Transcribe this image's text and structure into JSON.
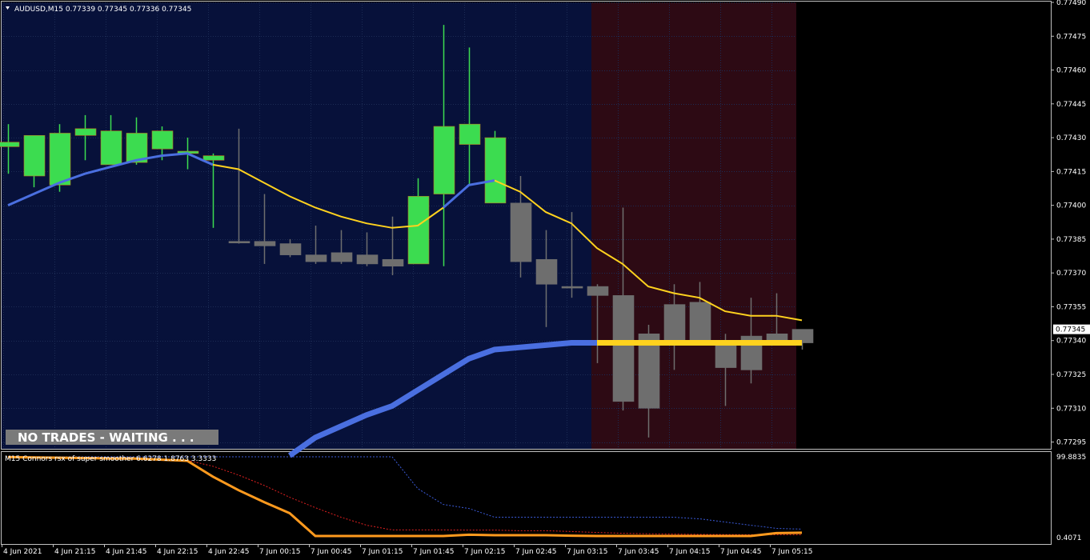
{
  "main_chart": {
    "title": "AUDUSD,M15  0.77339 0.77345 0.77336 0.77345",
    "current_price": "0.77345",
    "status_label": "NO TRADES - WAITING . . .",
    "colors": {
      "background": "#000000",
      "session_blue": "#07113a",
      "session_red": "#2d0a14",
      "grid": "#1c2c55",
      "bull": "#3cdc50",
      "neutral": "#6e6e6e",
      "ma_fast_up": "#4a6fe0",
      "ma_fast_down": "#ffd21e",
      "status_bg": "#7a7a7a"
    }
  },
  "time_axis": {
    "labels": [
      "4 Jun 2021",
      "4 Jun 21:15",
      "4 Jun 21:45",
      "4 Jun 22:15",
      "4 Jun 22:45",
      "7 Jun 00:15",
      "7 Jun 00:45",
      "7 Jun 01:15",
      "7 Jun 01:45",
      "7 Jun 02:15",
      "7 Jun 02:45",
      "7 Jun 03:15",
      "7 Jun 03:45",
      "7 Jun 04:15",
      "7 Jun 04:45",
      "7 Jun 05:15"
    ]
  },
  "indicator": {
    "title": "M15 Connors rsx of super smoother 6.6278 1.8763 3.3333",
    "labels": [
      "99.8835",
      "0.4071"
    ]
  },
  "chart_data": {
    "type": "candlestick",
    "price_ticks": [
      "0.77490",
      "0.77475",
      "0.77460",
      "0.77445",
      "0.77430",
      "0.77415",
      "0.77400",
      "0.77385",
      "0.77370",
      "0.77355",
      "0.77340",
      "0.77325",
      "0.77310",
      "0.77295"
    ],
    "ylim": [
      0.77292,
      0.7749
    ],
    "candles": [
      {
        "o": 0.77426,
        "h": 0.77436,
        "l": 0.77414,
        "c": 0.77428,
        "color": "bull"
      },
      {
        "o": 0.77413,
        "h": 0.7743,
        "l": 0.77408,
        "c": 0.77431,
        "color": "bull"
      },
      {
        "o": 0.77409,
        "h": 0.77436,
        "l": 0.77406,
        "c": 0.77432,
        "color": "bull"
      },
      {
        "o": 0.77431,
        "h": 0.7744,
        "l": 0.7742,
        "c": 0.77434,
        "color": "bull"
      },
      {
        "o": 0.77418,
        "h": 0.7744,
        "l": 0.77418,
        "c": 0.77433,
        "color": "bull"
      },
      {
        "o": 0.77419,
        "h": 0.77439,
        "l": 0.77418,
        "c": 0.77432,
        "color": "bull"
      },
      {
        "o": 0.77425,
        "h": 0.77435,
        "l": 0.7742,
        "c": 0.77433,
        "color": "bull"
      },
      {
        "o": 0.77423,
        "h": 0.7743,
        "l": 0.77416,
        "c": 0.77424,
        "color": "bull"
      },
      {
        "o": 0.7742,
        "h": 0.77423,
        "l": 0.7739,
        "c": 0.77422,
        "color": "bull"
      },
      {
        "o": 0.77384,
        "h": 0.77434,
        "l": 0.77383,
        "c": 0.77384,
        "color": "neutral"
      },
      {
        "o": 0.77384,
        "h": 0.77405,
        "l": 0.77374,
        "c": 0.77382,
        "color": "neutral"
      },
      {
        "o": 0.77383,
        "h": 0.77385,
        "l": 0.77377,
        "c": 0.77378,
        "color": "neutral"
      },
      {
        "o": 0.77378,
        "h": 0.77391,
        "l": 0.77374,
        "c": 0.77375,
        "color": "neutral"
      },
      {
        "o": 0.77379,
        "h": 0.77389,
        "l": 0.77374,
        "c": 0.77375,
        "color": "neutral"
      },
      {
        "o": 0.77378,
        "h": 0.77388,
        "l": 0.77373,
        "c": 0.77374,
        "color": "neutral"
      },
      {
        "o": 0.77376,
        "h": 0.77395,
        "l": 0.77369,
        "c": 0.77373,
        "color": "neutral"
      },
      {
        "o": 0.77374,
        "h": 0.77412,
        "l": 0.77374,
        "c": 0.77404,
        "color": "bull"
      },
      {
        "o": 0.77405,
        "h": 0.7748,
        "l": 0.77373,
        "c": 0.77435,
        "color": "bull"
      },
      {
        "o": 0.77427,
        "h": 0.7747,
        "l": 0.77409,
        "c": 0.77436,
        "color": "bull"
      },
      {
        "o": 0.77401,
        "h": 0.77433,
        "l": 0.77401,
        "c": 0.7743,
        "color": "bull"
      },
      {
        "o": 0.77401,
        "h": 0.77413,
        "l": 0.77368,
        "c": 0.77375,
        "color": "neutral"
      },
      {
        "o": 0.77376,
        "h": 0.77389,
        "l": 0.77346,
        "c": 0.77365,
        "color": "neutral"
      },
      {
        "o": 0.77364,
        "h": 0.77397,
        "l": 0.77359,
        "c": 0.77364,
        "color": "neutral"
      },
      {
        "o": 0.77364,
        "h": 0.77365,
        "l": 0.7733,
        "c": 0.7736,
        "color": "neutral"
      },
      {
        "o": 0.7736,
        "h": 0.77399,
        "l": 0.77309,
        "c": 0.77313,
        "color": "neutral"
      },
      {
        "o": 0.77343,
        "h": 0.77347,
        "l": 0.77297,
        "c": 0.7731,
        "color": "neutral"
      },
      {
        "o": 0.77356,
        "h": 0.77365,
        "l": 0.77327,
        "c": 0.7734,
        "color": "neutral"
      },
      {
        "o": 0.77357,
        "h": 0.77366,
        "l": 0.77338,
        "c": 0.77339,
        "color": "neutral"
      },
      {
        "o": 0.77339,
        "h": 0.77343,
        "l": 0.77311,
        "c": 0.77328,
        "color": "neutral"
      },
      {
        "o": 0.77342,
        "h": 0.77359,
        "l": 0.77321,
        "c": 0.77327,
        "color": "neutral"
      },
      {
        "o": 0.77343,
        "h": 0.77361,
        "l": 0.7734,
        "c": 0.7734,
        "color": "neutral"
      },
      {
        "o": 0.77339,
        "h": 0.77345,
        "l": 0.77336,
        "c": 0.77345,
        "color": "neutral"
      }
    ],
    "ma_thin": [
      0.774,
      0.77405,
      0.7741,
      0.77414,
      0.77417,
      0.7742,
      0.77422,
      0.77423,
      0.77418,
      0.77416,
      0.7741,
      0.77404,
      0.77399,
      0.77395,
      0.77392,
      0.7739,
      0.77391,
      0.77399,
      0.77409,
      0.77411,
      0.77406,
      0.77397,
      0.77392,
      0.77381,
      0.77374,
      0.77364,
      0.77361,
      0.77359,
      0.77353,
      0.77351,
      0.77351,
      0.77349
    ],
    "ma_thick": [
      null,
      null,
      null,
      null,
      null,
      null,
      null,
      null,
      null,
      null,
      null,
      0.77289,
      0.77297,
      0.77302,
      0.77307,
      0.77311,
      0.77318,
      0.77325,
      0.77332,
      0.77336,
      0.77337,
      0.77338,
      0.77339,
      0.77339,
      0.77339,
      0.77339,
      0.77339,
      0.77339,
      0.77339,
      0.77339,
      0.77339,
      0.77339
    ],
    "indicator_lines": {
      "orange": [
        99.5,
        99.2,
        98.8,
        98.4,
        97.8,
        97.6,
        96.3,
        94.9,
        75.0,
        58.0,
        43.0,
        29.0,
        0.4,
        0.4,
        0.4,
        0.4,
        0.4,
        0.4,
        2.0,
        1.4,
        1.4,
        1.4,
        0.8,
        0.4,
        0.4,
        0.4,
        0.4,
        0.4,
        0.4,
        0.4,
        4.0,
        4.5
      ],
      "red_dashed": [
        99.5,
        99.2,
        98.8,
        98.4,
        97.8,
        97.6,
        96.3,
        95.5,
        88.0,
        77.0,
        64.0,
        49.0,
        36.0,
        24.0,
        14.0,
        8.0,
        8.0,
        8.0,
        7.8,
        7.8,
        7.0,
        7.0,
        6.0,
        4.8,
        3.8,
        3.2,
        2.8,
        2.4,
        2.2,
        2.0,
        2.0,
        2.0
      ],
      "blue_dashed": [
        99.88,
        99.88,
        99.88,
        99.88,
        99.88,
        99.88,
        99.88,
        99.88,
        99.88,
        99.88,
        99.88,
        99.88,
        99.88,
        99.88,
        99.88,
        99.88,
        60.0,
        40.0,
        35.0,
        24.0,
        24.0,
        24.0,
        24.0,
        24.0,
        24.0,
        24.0,
        24.0,
        22.0,
        18.0,
        14.0,
        10.0,
        9.0
      ],
      "ylim": [
        0.4071,
        99.8835
      ]
    }
  }
}
